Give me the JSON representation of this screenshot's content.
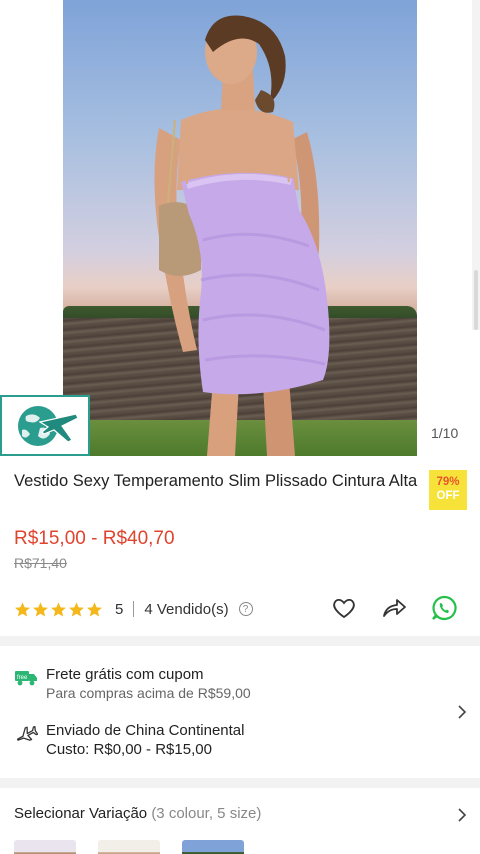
{
  "gallery": {
    "counter": "1/10",
    "logo_icon": "globe-plane-icon"
  },
  "product": {
    "title": "Vestido Sexy Temperamento Slim Plissado Cintura Alta",
    "discount_percent": "79%",
    "discount_label": "OFF",
    "price_range": "R$15,00 - R$40,70",
    "original_price": "R$71,40",
    "rating": "5",
    "stars": 5,
    "sold": "4 Vendido(s)",
    "help_icon": "?"
  },
  "actions": {
    "favorite_icon": "heart-icon",
    "share_icon": "share-icon",
    "whatsapp_icon": "whatsapp-icon"
  },
  "shipping": {
    "free_title": "Frete grátis com cupom",
    "free_sub": "Para compras acima de R$59,00",
    "origin_title": "Enviado de China Continental",
    "origin_cost": "Custo: R$0,00 - R$15,00"
  },
  "variation": {
    "label": "Selecionar Variação",
    "detail": "(3 colour, 5 size)"
  },
  "colors": {
    "price": "#e0442e",
    "badge_bg": "#f7e23a",
    "whatsapp": "#25c04b",
    "ship_icon": "#2bb673"
  }
}
